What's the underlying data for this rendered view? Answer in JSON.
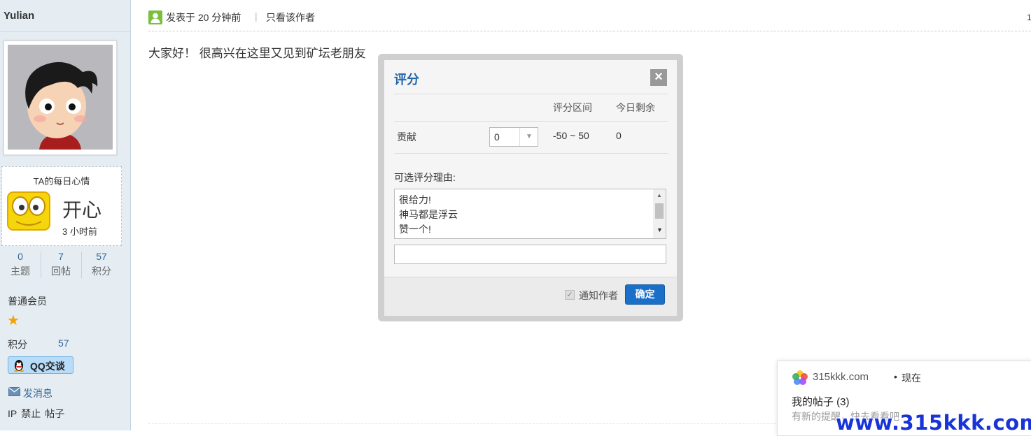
{
  "sidebar": {
    "username": "Yulian",
    "mood": {
      "title": "TA的每日心情",
      "word": "开心",
      "time": "3 小时前"
    },
    "stats": [
      {
        "num": "0",
        "label": "主题"
      },
      {
        "num": "7",
        "label": "回帖"
      },
      {
        "num": "57",
        "label": "积分"
      }
    ],
    "group": "普通会员",
    "credits_label": "积分",
    "credits_value": "57",
    "qq_label": "QQ交谈",
    "message_label": "发消息",
    "admin_links": [
      "IP",
      "禁止",
      "帖子"
    ]
  },
  "post": {
    "time": "发表于 20 分钟前",
    "separator": "|",
    "only_author": "只看该作者",
    "body": "大家好！ 很高兴在这里又见到矿坛老朋友",
    "corner_mark": "1"
  },
  "dialog": {
    "title": "评分",
    "close": "×",
    "headers": {
      "range": "评分区间",
      "remaining": "今日剩余"
    },
    "row": {
      "name": "贡献",
      "select_value": "0",
      "range": "-50 ~ 50",
      "remaining": "0"
    },
    "reason_label": "可选评分理由:",
    "reasons": [
      "很给力!",
      "神马都是浮云",
      "赞一个!"
    ],
    "reason_input_value": "",
    "notify_label": "通知作者",
    "notify_checked": true,
    "ok_label": "确定"
  },
  "notification": {
    "site": "315kkk.com",
    "dot": "•",
    "time": "现在",
    "title": "我的帖子 (3)",
    "desc": "有新的提醒，快去看看吧"
  },
  "watermark": "www.315kkk.com"
}
